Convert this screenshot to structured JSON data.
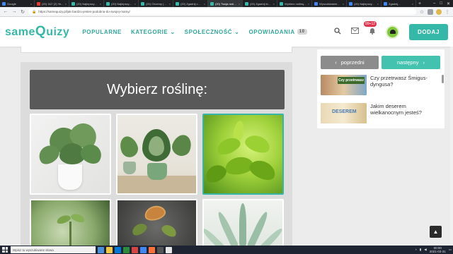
{
  "browser": {
    "tabs": [
      {
        "title": "Google",
        "color": "#4285f4",
        "active": false
      },
      {
        "title": "(20) 'AO' (2) Ye...",
        "color": "#e53935",
        "active": false
      },
      {
        "title": "(20) Najlepszy quiz...",
        "color": "#35b8a7",
        "active": false
      },
      {
        "title": "(20) Najlepszy quiz...",
        "color": "#35b8a7",
        "active": false
      },
      {
        "title": "(20) Chcemy (2)...",
        "color": "#35b8a7",
        "active": false
      },
      {
        "title": "(20) Zgadnij co ...",
        "color": "#35b8a7",
        "active": false
      },
      {
        "title": "(20) Twoja roślina...",
        "color": "#35b8a7",
        "active": true
      },
      {
        "title": "(20) Zgadnij który...",
        "color": "#35b8a7",
        "active": false
      },
      {
        "title": "Wybierz roślinę...",
        "color": "#35b8a7",
        "active": false
      },
      {
        "title": "Wyszukiwanie...",
        "color": "#4285f4",
        "active": false
      },
      {
        "title": "(20) Najlepszy...",
        "color": "#4285f4",
        "active": false
      },
      {
        "title": "Zgadnij...",
        "color": "#4285f4",
        "active": false
      }
    ],
    "url": "https://samequizy.pl/jak-bardzo-jestes-podobna-do-swojej-mamy/"
  },
  "header": {
    "logo_part1": "same",
    "logo_q": "Q",
    "logo_part2": "uizy",
    "menu": [
      {
        "label": "POPULARNE",
        "has_dropdown": false
      },
      {
        "label": "KATEGORIE",
        "has_dropdown": true
      },
      {
        "label": "SPOŁECZNOŚĆ",
        "has_dropdown": true
      },
      {
        "label": "OPOWIADANIA",
        "has_dropdown": false,
        "count": "10"
      }
    ],
    "notification_count": "99+12",
    "add_label": "DODAJ"
  },
  "quiz": {
    "question": "Wybierz roślinę:",
    "answers": [
      {
        "name": "monstera-plant",
        "selected": false
      },
      {
        "name": "alocasia-plants",
        "selected": false
      },
      {
        "name": "tea-plant",
        "selected": true
      },
      {
        "name": "seedling-plant",
        "selected": false
      },
      {
        "name": "venus-flytrap-plant",
        "selected": false
      },
      {
        "name": "aloe-plant",
        "selected": false
      }
    ]
  },
  "sidebar": {
    "prev_label": "poprzedni",
    "next_label": "następny",
    "related": [
      {
        "title": "Czy przetrwasz Śmigus-dyngusa?",
        "thumb_text": "Czy przetrwasz"
      },
      {
        "title": "Jakim deserem wielkanocnym jesteś?",
        "thumb_text": "DESEREM"
      }
    ]
  },
  "taskbar": {
    "search_placeholder": "Wpisz tu wyszukiwane słowa",
    "time": "00:00",
    "date": "2021-03-31",
    "apps": [
      "#4a90d9",
      "#f2c744",
      "#0078d7",
      "#2d8c3c",
      "#d64541",
      "#4285f4",
      "#ff7139",
      "#555555",
      "#e6e6e6"
    ]
  },
  "colors": {
    "brand": "#35b8a7",
    "selected_border": "#37b6a8",
    "question_bg": "#595959",
    "prev_btn": "#8c8c8c",
    "next_btn": "#44c2b0"
  }
}
